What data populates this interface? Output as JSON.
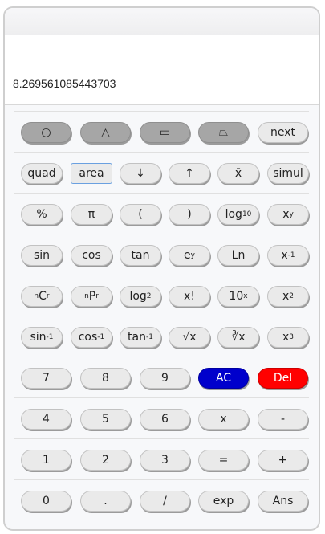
{
  "display": {
    "value": "8.269561085443703"
  },
  "rows": [
    {
      "buttons": [
        {
          "name": "circle-shape-button",
          "label": "○"
        },
        {
          "name": "triangle-shape-button",
          "label": "△"
        },
        {
          "name": "rectangle-shape-button",
          "label": "▭"
        },
        {
          "name": "trapezoid-shape-button",
          "label": "⏢"
        },
        {
          "name": "next-button",
          "label": "next"
        }
      ]
    },
    {
      "buttons": [
        {
          "name": "quad-button",
          "label": "quad"
        },
        {
          "name": "area-button",
          "label": "area"
        },
        {
          "name": "down-arrow-button",
          "label": "↓"
        },
        {
          "name": "up-arrow-button",
          "label": "↑"
        },
        {
          "name": "mean-button",
          "label": "x̄"
        },
        {
          "name": "simul-button",
          "label": "simul"
        }
      ]
    },
    {
      "buttons": [
        {
          "name": "percent-button",
          "label": "%"
        },
        {
          "name": "pi-button",
          "label": "π"
        },
        {
          "name": "open-paren-button",
          "label": "("
        },
        {
          "name": "close-paren-button",
          "label": ")"
        },
        {
          "name": "log10-button",
          "label": "log",
          "sub": "10"
        },
        {
          "name": "power-button",
          "label": "x",
          "sup": "y"
        }
      ]
    },
    {
      "buttons": [
        {
          "name": "sin-button",
          "label": "sin"
        },
        {
          "name": "cos-button",
          "label": "cos"
        },
        {
          "name": "tan-button",
          "label": "tan"
        },
        {
          "name": "exp-power-button",
          "label": "e",
          "sup": "y"
        },
        {
          "name": "ln-button",
          "label": "Ln"
        },
        {
          "name": "reciprocal-button",
          "label": "x",
          "sup": "-1"
        }
      ]
    },
    {
      "buttons": [
        {
          "name": "ncr-button",
          "pre": "n",
          "label": "C",
          "sub": "r"
        },
        {
          "name": "npr-button",
          "pre": "n",
          "label": "P",
          "sub": "r"
        },
        {
          "name": "log2-button",
          "label": "log",
          "sub": "2"
        },
        {
          "name": "factorial-button",
          "label": "x!"
        },
        {
          "name": "ten-power-button",
          "label": "10",
          "sup": "x"
        },
        {
          "name": "square-button",
          "label": "x",
          "sup": "2"
        }
      ]
    },
    {
      "buttons": [
        {
          "name": "arcsin-button",
          "label": "sin",
          "sup": "-1"
        },
        {
          "name": "arccos-button",
          "label": "cos",
          "sup": "-1"
        },
        {
          "name": "arctan-button",
          "label": "tan",
          "sup": "-1"
        },
        {
          "name": "sqrt-button",
          "label": "√x"
        },
        {
          "name": "cbrt-button",
          "label": "∛x"
        },
        {
          "name": "cube-button",
          "label": "x",
          "sup": "3"
        }
      ]
    },
    {
      "buttons": [
        {
          "name": "digit-7-button",
          "label": "7"
        },
        {
          "name": "digit-8-button",
          "label": "8"
        },
        {
          "name": "digit-9-button",
          "label": "9"
        },
        {
          "name": "all-clear-button",
          "label": "AC"
        },
        {
          "name": "delete-button",
          "label": "Del"
        }
      ]
    },
    {
      "buttons": [
        {
          "name": "digit-4-button",
          "label": "4"
        },
        {
          "name": "digit-5-button",
          "label": "5"
        },
        {
          "name": "digit-6-button",
          "label": "6"
        },
        {
          "name": "multiply-button",
          "label": "x"
        },
        {
          "name": "minus-button",
          "label": "-"
        }
      ]
    },
    {
      "buttons": [
        {
          "name": "digit-1-button",
          "label": "1"
        },
        {
          "name": "digit-2-button",
          "label": "2"
        },
        {
          "name": "digit-3-button",
          "label": "3"
        },
        {
          "name": "equals-button",
          "label": "="
        },
        {
          "name": "plus-button",
          "label": "+"
        }
      ]
    },
    {
      "buttons": [
        {
          "name": "digit-0-button",
          "label": "0"
        },
        {
          "name": "decimal-button",
          "label": "."
        },
        {
          "name": "divide-button",
          "label": "/"
        },
        {
          "name": "exp-button",
          "label": "exp"
        },
        {
          "name": "ans-button",
          "label": "Ans"
        }
      ]
    }
  ],
  "colors": {
    "ac": "#0000cc",
    "del": "#ff0000",
    "shape": "#a6a6a6"
  }
}
